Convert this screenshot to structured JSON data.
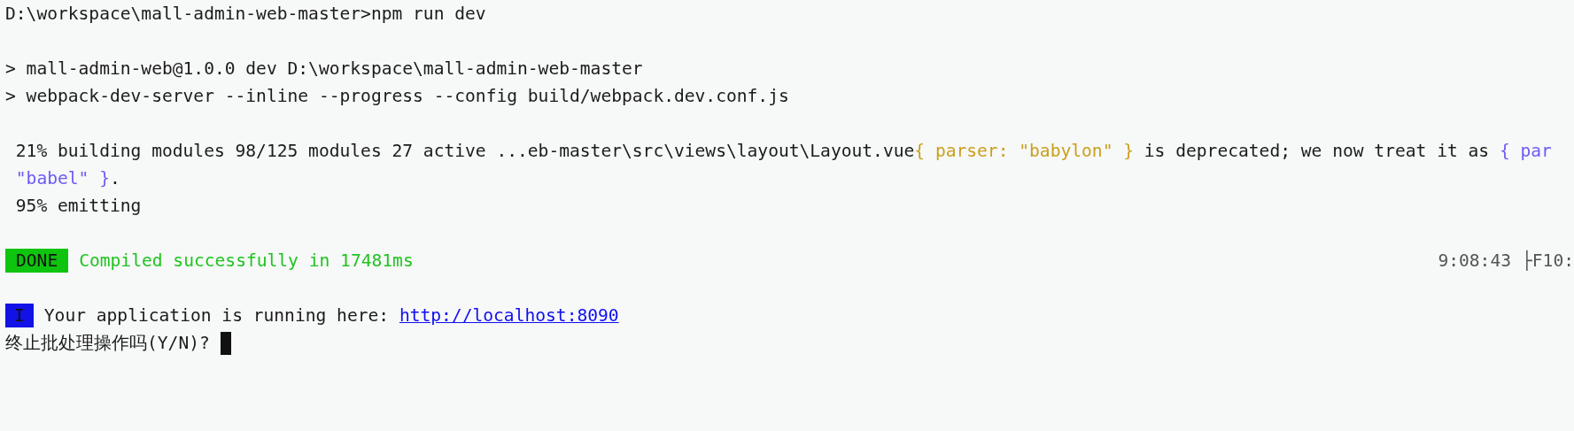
{
  "blocks": [
    [
      {
        "segments": [
          {
            "kind": "plain",
            "text": "D:\\workspace\\mall-admin-web-master>npm run dev"
          }
        ]
      }
    ],
    [
      {
        "segments": [
          {
            "kind": "plain",
            "text": "> mall-admin-web@1.0.0 dev D:\\workspace\\mall-admin-web-master"
          }
        ]
      },
      {
        "segments": [
          {
            "kind": "plain",
            "text": "> webpack-dev-server --inline --progress --config build/webpack.dev.conf.js"
          }
        ]
      }
    ],
    [
      {
        "segments": [
          {
            "kind": "plain",
            "text": " 21% building modules 98/125 modules 27 active ...eb-master\\src\\views\\layout\\Layout.vue"
          },
          {
            "kind": "warn",
            "text": "{ parser: \"babylon\" }"
          },
          {
            "kind": "plain",
            "text": " is deprecated; we now treat it as "
          },
          {
            "kind": "info",
            "text": "{ par"
          }
        ]
      },
      {
        "segments": [
          {
            "kind": "info",
            "text": " \"babel\" }"
          },
          {
            "kind": "plain",
            "text": "."
          }
        ]
      },
      {
        "segments": [
          {
            "kind": "plain",
            "text": " 95% emitting"
          }
        ]
      }
    ],
    [
      {
        "segments": [
          {
            "kind": "badge_done",
            "text": "DONE"
          },
          {
            "kind": "success",
            "text": "Compiled successfully in 17481ms"
          }
        ],
        "right": [
          {
            "kind": "time",
            "text": "9:08:43"
          },
          {
            "kind": "time",
            "text": "├F10:"
          }
        ]
      }
    ],
    [
      {
        "segments": [
          {
            "kind": "badge_info",
            "text": "I"
          },
          {
            "kind": "plain",
            "text": "Your application is running here: "
          },
          {
            "kind": "link",
            "text": "http://localhost:8090"
          }
        ]
      },
      {
        "segments": [
          {
            "kind": "plain",
            "text": "终止批处理操作吗(Y/N)? "
          },
          {
            "kind": "cursor"
          }
        ]
      }
    ]
  ]
}
